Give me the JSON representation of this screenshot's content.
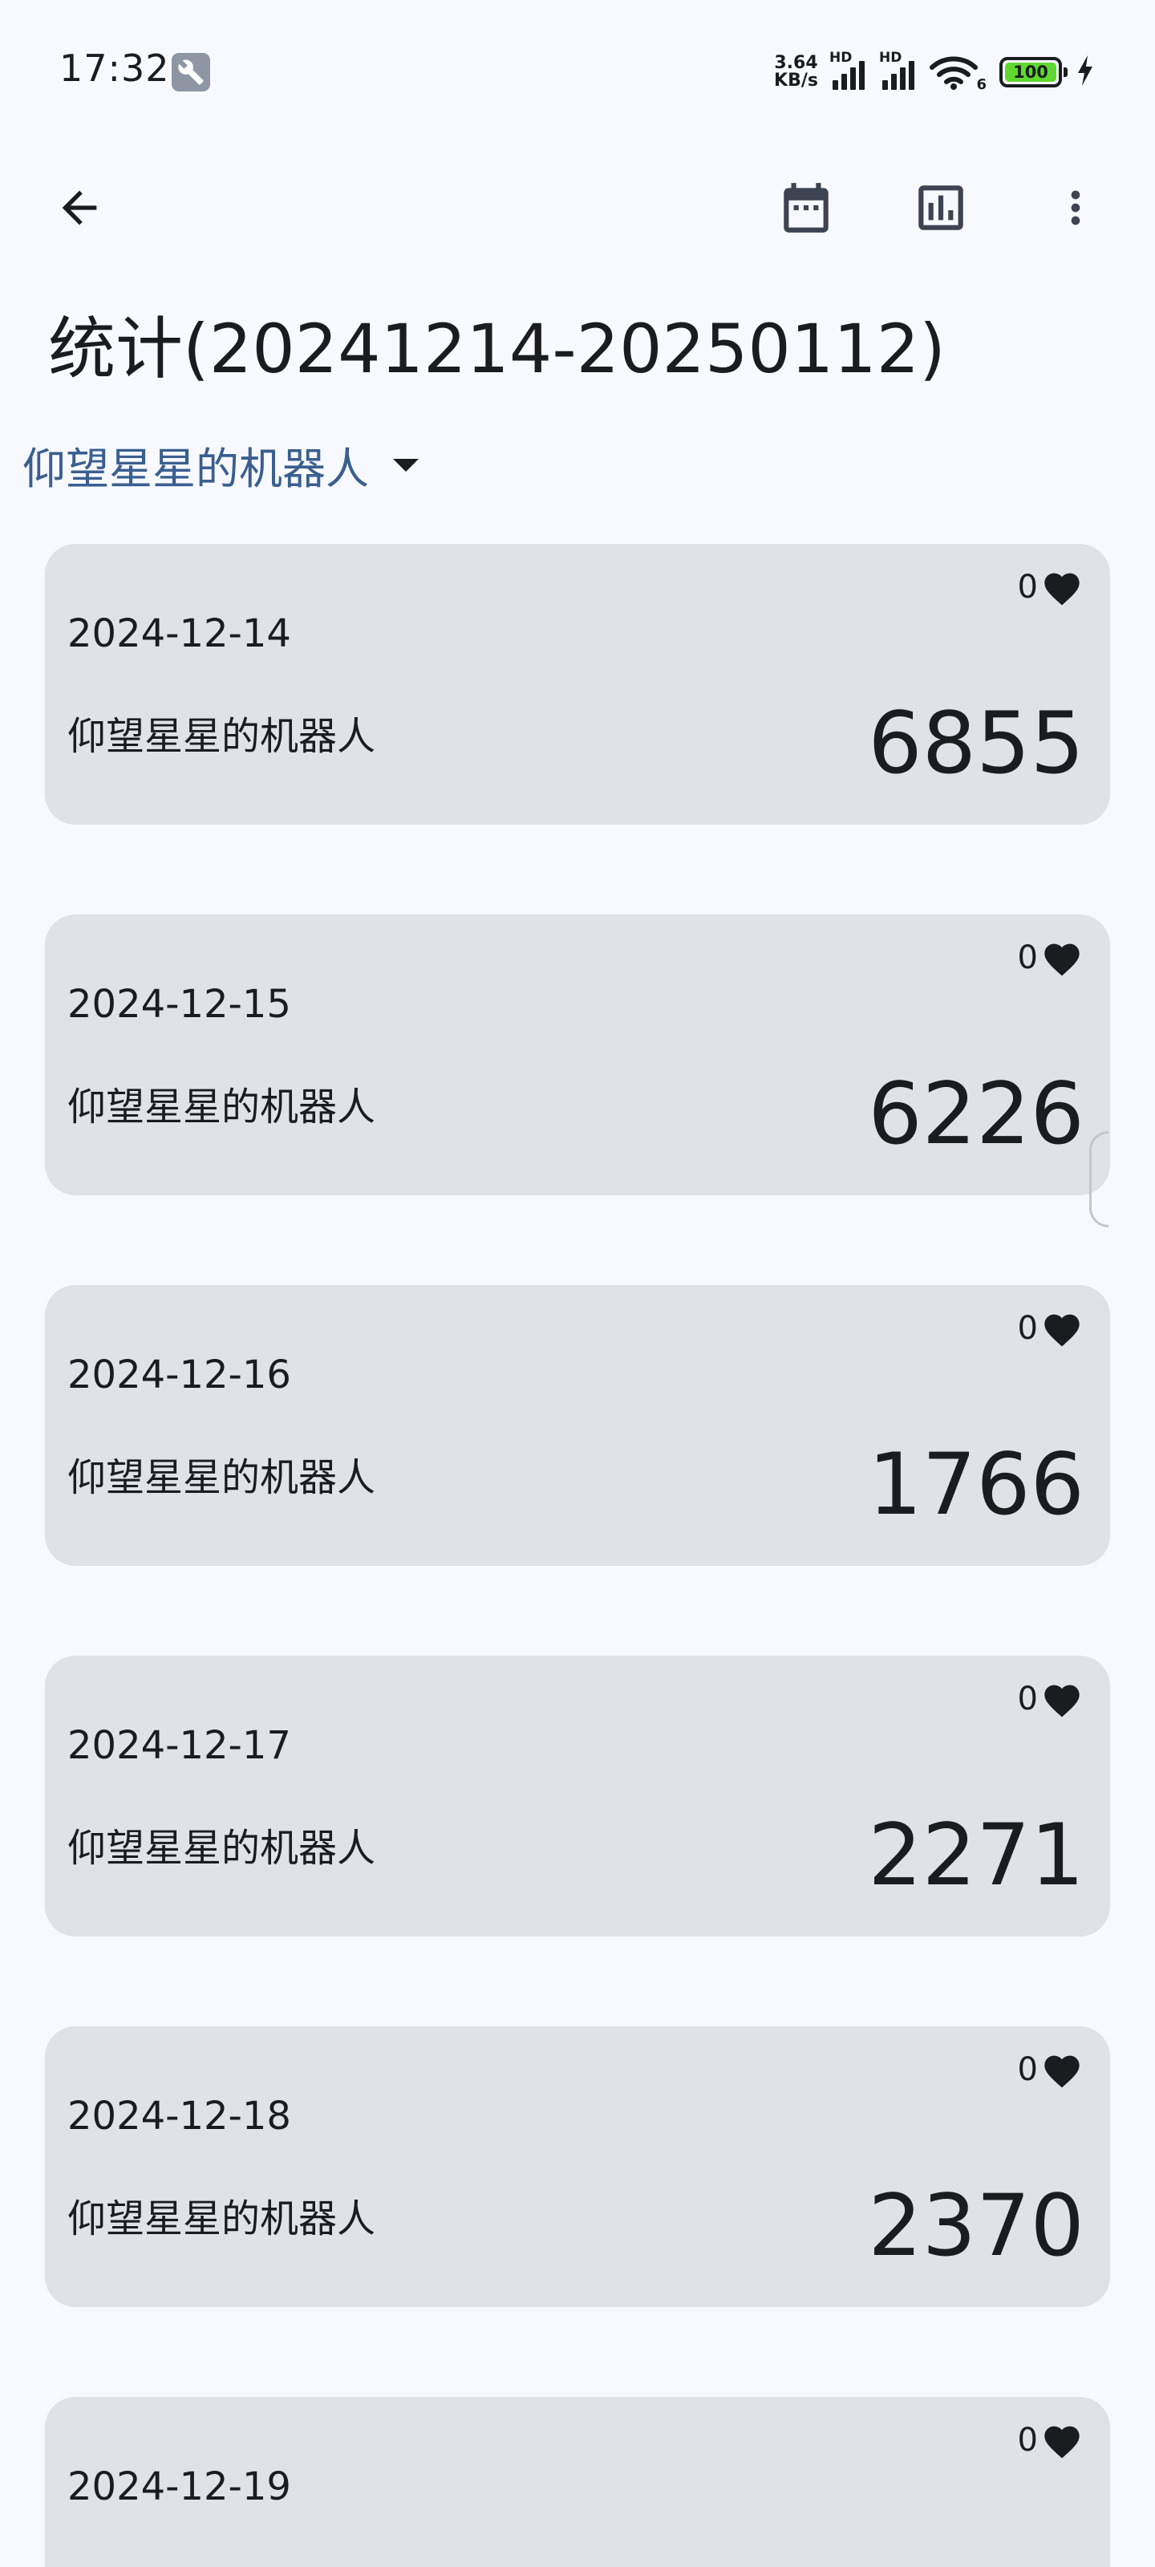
{
  "status_bar": {
    "time": "17:32",
    "net_speed_value": "3.64",
    "net_speed_unit": "KB/s",
    "sim1_label": "HD",
    "sim2_label": "HD",
    "wifi_label": "6",
    "battery_level": "100"
  },
  "header": {
    "title": "统计(20241214-20250112)"
  },
  "selector": {
    "value": "仰望星星的机器人"
  },
  "cards": [
    {
      "likes": "0",
      "date": "2024-12-14",
      "name": "仰望星星的机器人",
      "steps": "6855"
    },
    {
      "likes": "0",
      "date": "2024-12-15",
      "name": "仰望星星的机器人",
      "steps": "6226"
    },
    {
      "likes": "0",
      "date": "2024-12-16",
      "name": "仰望星星的机器人",
      "steps": "1766"
    },
    {
      "likes": "0",
      "date": "2024-12-17",
      "name": "仰望星星的机器人",
      "steps": "2271"
    },
    {
      "likes": "0",
      "date": "2024-12-18",
      "name": "仰望星星的机器人",
      "steps": "2370"
    },
    {
      "likes": "0",
      "date": "2024-12-19",
      "name": "",
      "steps": ""
    }
  ],
  "icons": {
    "back": "arrow-left-icon",
    "calendar": "calendar-icon",
    "chart": "bar-chart-icon",
    "more": "more-vert-icon",
    "like": "heart-icon",
    "dropdown": "triangle-down-icon"
  },
  "colors": {
    "background": "#f7f9fe",
    "card": "#e1e2e8",
    "accent": "#3a5f8f",
    "battery": "#5fd82f"
  }
}
